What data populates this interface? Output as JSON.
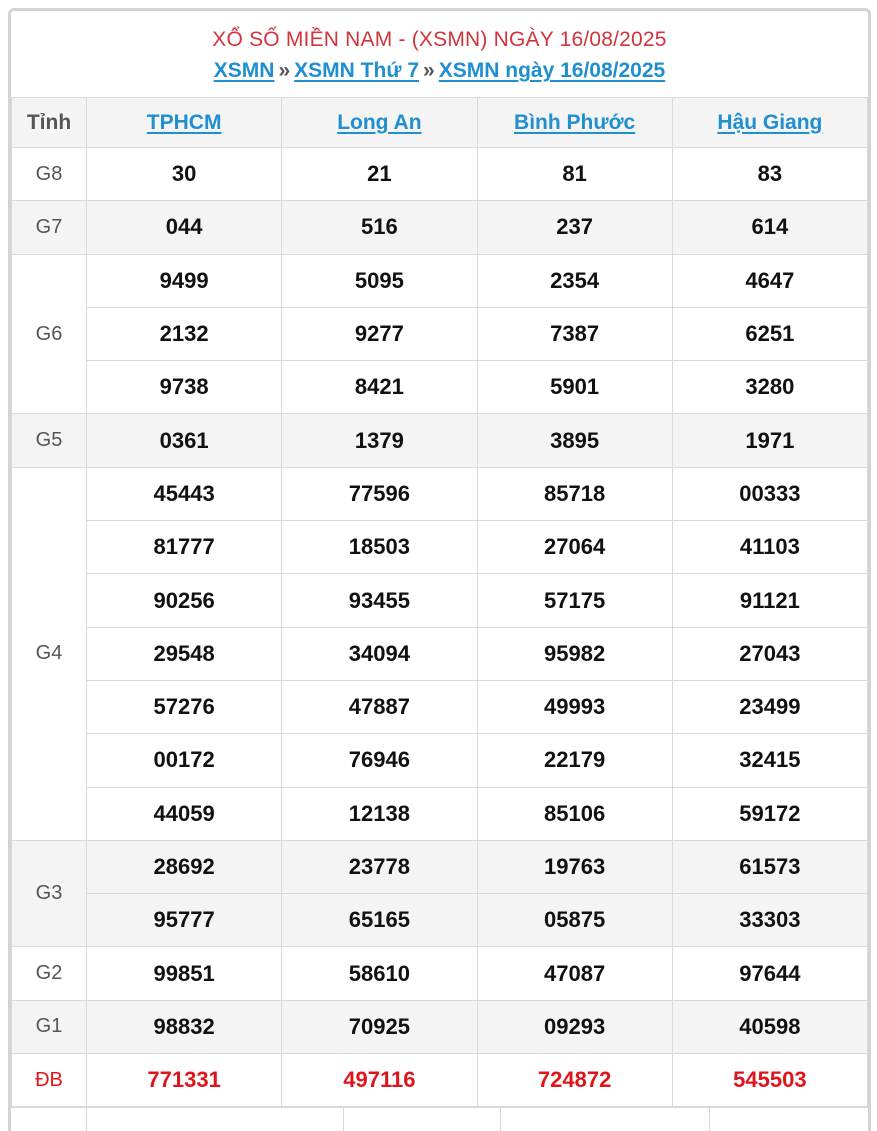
{
  "header": {
    "title": "XỔ SỐ MIỀN NAM - (XSMN) NGÀY 16/08/2025",
    "breadcrumb": [
      "XSMN",
      "XSMN Thứ 7",
      "XSMN ngày 16/08/2025"
    ],
    "separator": "»"
  },
  "table": {
    "corner_label": "Tỉnh",
    "provinces": [
      "TPHCM",
      "Long An",
      "Bình Phước",
      "Hậu Giang"
    ],
    "prizes": [
      {
        "label": "G8",
        "rows": [
          [
            "30",
            "21",
            "81",
            "83"
          ]
        ]
      },
      {
        "label": "G7",
        "rows": [
          [
            "044",
            "516",
            "237",
            "614"
          ]
        ]
      },
      {
        "label": "G6",
        "rows": [
          [
            "9499",
            "5095",
            "2354",
            "4647"
          ],
          [
            "2132",
            "9277",
            "7387",
            "6251"
          ],
          [
            "9738",
            "8421",
            "5901",
            "3280"
          ]
        ]
      },
      {
        "label": "G5",
        "rows": [
          [
            "0361",
            "1379",
            "3895",
            "1971"
          ]
        ]
      },
      {
        "label": "G4",
        "rows": [
          [
            "45443",
            "77596",
            "85718",
            "00333"
          ],
          [
            "81777",
            "18503",
            "27064",
            "41103"
          ],
          [
            "90256",
            "93455",
            "57175",
            "91121"
          ],
          [
            "29548",
            "34094",
            "95982",
            "27043"
          ],
          [
            "57276",
            "47887",
            "49993",
            "23499"
          ],
          [
            "00172",
            "76946",
            "22179",
            "32415"
          ],
          [
            "44059",
            "12138",
            "85106",
            "59172"
          ]
        ]
      },
      {
        "label": "G3",
        "rows": [
          [
            "28692",
            "23778",
            "19763",
            "61573"
          ],
          [
            "95777",
            "65165",
            "05875",
            "33303"
          ]
        ]
      },
      {
        "label": "G2",
        "rows": [
          [
            "99851",
            "58610",
            "47087",
            "97644"
          ]
        ]
      },
      {
        "label": "G1",
        "rows": [
          [
            "98832",
            "70925",
            "09293",
            "40598"
          ]
        ]
      },
      {
        "label": "ĐB",
        "rows": [
          [
            "771331",
            "497116",
            "724872",
            "545503"
          ]
        ]
      }
    ]
  },
  "colors": {
    "title": "#d1343c",
    "link": "#1f8fd0",
    "special": "#e0141b",
    "alt_row": "#f4f4f4"
  }
}
